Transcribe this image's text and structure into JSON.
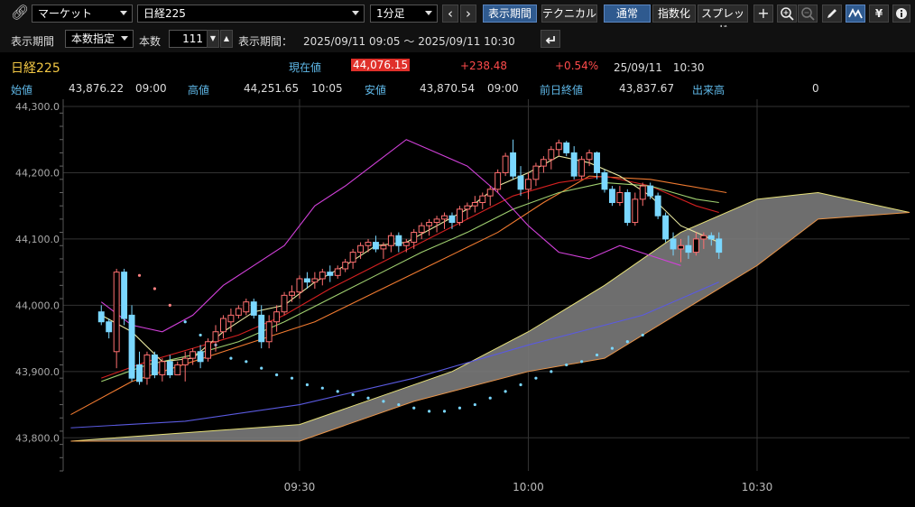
{
  "toolbar": {
    "link_icon": "link-icon",
    "market_select": "マーケット",
    "symbol_select": "日経225",
    "interval_select": "1分足",
    "prev_label": "‹",
    "next_label": "›",
    "period_button": "表示期間",
    "technical_button": "テクニカル",
    "normal_button": "通常",
    "index_button": "指数化",
    "spread_button": "スプレッド",
    "icons": [
      "crosshair-icon",
      "zoom-in-icon",
      "zoom-out-icon",
      "pencil-icon",
      "chart-style-icon",
      "yen-icon",
      "info-icon"
    ]
  },
  "period": {
    "label": "表示期間",
    "mode_select": "本数指定",
    "count_label": "本数",
    "count_value": "111",
    "range_label": "表示期間：",
    "range_value": "2025/09/11 09:05 ～ 2025/09/11 10:30"
  },
  "quote": {
    "name": "日経225",
    "current_label": "現在値",
    "current_value": "44,076.15",
    "change": "+238.48",
    "change_pct": "+0.54%",
    "datetime": "25/09/11　10:30",
    "open_label": "始値",
    "open_value": "43,876.22",
    "open_time": "09:00",
    "high_label": "高値",
    "high_value": "44,251.65",
    "high_time": "10:05",
    "low_label": "安値",
    "low_value": "43,870.54",
    "low_time": "09:00",
    "prev_close_label": "前日終値",
    "prev_close_value": "43,837.67",
    "volume_label": "出来高",
    "volume_value": "0",
    "colors": {
      "up": "#ff4b4b",
      "label": "#5fb8e8",
      "name": "#f2c744"
    }
  },
  "chart_data": {
    "type": "candlestick",
    "ylim": [
      43750,
      44300
    ],
    "y_ticks": [
      "44,300.0",
      "44,200.0",
      "44,100.0",
      "44,000.0",
      "43,900.0",
      "43,800.0"
    ],
    "x_ticks": [
      "09:30",
      "10:00",
      "10:30"
    ],
    "x_tick_minutes": [
      30,
      60,
      90
    ],
    "x_range_minutes": [
      -1,
      110
    ],
    "grid": true,
    "candles": [
      [
        4,
        43990,
        44000,
        43970,
        43975
      ],
      [
        5,
        43975,
        43980,
        43950,
        43960
      ],
      [
        6,
        43930,
        44055,
        43905,
        44050
      ],
      [
        7,
        44050,
        44055,
        43970,
        43980
      ],
      [
        8,
        43985,
        44000,
        43885,
        43890
      ],
      [
        9,
        43910,
        43930,
        43880,
        43885
      ],
      [
        10,
        43890,
        43930,
        43880,
        43925
      ],
      [
        11,
        43925,
        43930,
        43890,
        43895
      ],
      [
        12,
        43895,
        43920,
        43885,
        43915
      ],
      [
        13,
        43915,
        43925,
        43890,
        43895
      ],
      [
        14,
        43895,
        43915,
        43895,
        43910
      ],
      [
        15,
        43910,
        43930,
        43885,
        43920
      ],
      [
        16,
        43920,
        43935,
        43910,
        43930
      ],
      [
        17,
        43930,
        43940,
        43905,
        43915
      ],
      [
        18,
        43920,
        43950,
        43915,
        43945
      ],
      [
        19,
        43945,
        43970,
        43930,
        43960
      ],
      [
        20,
        43960,
        43985,
        43950,
        43980
      ],
      [
        21,
        43975,
        43995,
        43960,
        43985
      ],
      [
        22,
        43985,
        44000,
        43980,
        43995
      ],
      [
        23,
        43990,
        44010,
        43985,
        44005
      ],
      [
        24,
        44005,
        44010,
        43980,
        43985
      ],
      [
        25,
        43985,
        44000,
        43935,
        43945
      ],
      [
        26,
        43945,
        43985,
        43935,
        43975
      ],
      [
        27,
        43975,
        44000,
        43960,
        43990
      ],
      [
        28,
        43990,
        44020,
        43985,
        44015
      ],
      [
        29,
        44015,
        44030,
        44005,
        44020
      ],
      [
        30,
        44020,
        44045,
        44010,
        44040
      ],
      [
        31,
        44040,
        44050,
        44025,
        44035
      ],
      [
        32,
        44035,
        44050,
        44025,
        44040
      ],
      [
        33,
        44040,
        44055,
        44030,
        44050
      ],
      [
        34,
        44050,
        44060,
        44035,
        44045
      ],
      [
        35,
        44045,
        44060,
        44040,
        44055
      ],
      [
        36,
        44055,
        44070,
        44050,
        44065
      ],
      [
        37,
        44065,
        44085,
        44055,
        44080
      ],
      [
        38,
        44080,
        44095,
        44070,
        44090
      ],
      [
        39,
        44090,
        44100,
        44080,
        44095
      ],
      [
        40,
        44095,
        44105,
        44080,
        44085
      ],
      [
        41,
        44085,
        44095,
        44070,
        44090
      ],
      [
        42,
        44090,
        44110,
        44080,
        44105
      ],
      [
        43,
        44105,
        44110,
        44080,
        44090
      ],
      [
        44,
        44090,
        44100,
        44080,
        44095
      ],
      [
        45,
        44095,
        44115,
        44085,
        44110
      ],
      [
        46,
        44110,
        44125,
        44100,
        44120
      ],
      [
        47,
        44120,
        44130,
        44105,
        44125
      ],
      [
        48,
        44125,
        44135,
        44110,
        44130
      ],
      [
        49,
        44130,
        44140,
        44115,
        44135
      ],
      [
        50,
        44135,
        44140,
        44115,
        44125
      ],
      [
        51,
        44125,
        44150,
        44120,
        44145
      ],
      [
        52,
        44145,
        44155,
        44130,
        44150
      ],
      [
        53,
        44150,
        44165,
        44140,
        44155
      ],
      [
        54,
        44155,
        44170,
        44145,
        44165
      ],
      [
        55,
        44165,
        44180,
        44150,
        44175
      ],
      [
        56,
        44175,
        44205,
        44170,
        44200
      ],
      [
        57,
        44200,
        44230,
        44195,
        44225
      ],
      [
        58,
        44230,
        44250,
        44190,
        44195
      ],
      [
        59,
        44195,
        44210,
        44165,
        44175
      ],
      [
        60,
        44175,
        44200,
        44160,
        44190
      ],
      [
        61,
        44190,
        44215,
        44180,
        44210
      ],
      [
        62,
        44210,
        44225,
        44200,
        44220
      ],
      [
        63,
        44220,
        44240,
        44205,
        44235
      ],
      [
        64,
        44235,
        44250,
        44225,
        44245
      ],
      [
        65,
        44245,
        44248,
        44225,
        44230
      ],
      [
        66,
        44230,
        44240,
        44190,
        44195
      ],
      [
        67,
        44195,
        44225,
        44190,
        44220
      ],
      [
        68,
        44220,
        44235,
        44210,
        44230
      ],
      [
        69,
        44230,
        44232,
        44190,
        44200
      ],
      [
        70,
        44200,
        44205,
        44170,
        44175
      ],
      [
        71,
        44175,
        44180,
        44150,
        44155
      ],
      [
        72,
        44155,
        44180,
        44150,
        44170
      ],
      [
        73,
        44170,
        44175,
        44120,
        44125
      ],
      [
        74,
        44125,
        44170,
        44120,
        44160
      ],
      [
        75,
        44160,
        44185,
        44150,
        44180
      ],
      [
        76,
        44180,
        44185,
        44160,
        44165
      ],
      [
        77,
        44165,
        44170,
        44130,
        44135
      ],
      [
        78,
        44135,
        44140,
        44095,
        44100
      ],
      [
        79,
        44100,
        44110,
        44075,
        44085
      ],
      [
        80,
        44085,
        44100,
        44065,
        44090
      ],
      [
        81,
        44090,
        44105,
        44070,
        44080
      ],
      [
        82,
        44080,
        44110,
        44075,
        44100
      ],
      [
        83,
        44100,
        44110,
        44085,
        44105
      ],
      [
        84,
        44105,
        44110,
        44090,
        44100
      ],
      [
        85,
        44100,
        44110,
        44070,
        44080
      ]
    ],
    "sma_short": [
      [
        4,
        43985
      ],
      [
        8,
        43960
      ],
      [
        12,
        43915
      ],
      [
        16,
        43920
      ],
      [
        20,
        43960
      ],
      [
        24,
        43990
      ],
      [
        28,
        44000
      ],
      [
        32,
        44035
      ],
      [
        36,
        44060
      ],
      [
        40,
        44090
      ],
      [
        44,
        44095
      ],
      [
        48,
        44120
      ],
      [
        52,
        44145
      ],
      [
        56,
        44180
      ],
      [
        60,
        44200
      ],
      [
        64,
        44225
      ],
      [
        68,
        44215
      ],
      [
        72,
        44195
      ],
      [
        76,
        44165
      ],
      [
        80,
        44120
      ],
      [
        85,
        44095
      ]
    ],
    "sma_long": [
      [
        4,
        43885
      ],
      [
        10,
        43910
      ],
      [
        16,
        43925
      ],
      [
        22,
        43945
      ],
      [
        28,
        43975
      ],
      [
        34,
        44010
      ],
      [
        40,
        44045
      ],
      [
        46,
        44080
      ],
      [
        52,
        44110
      ],
      [
        58,
        44145
      ],
      [
        64,
        44170
      ],
      [
        70,
        44185
      ],
      [
        76,
        44180
      ],
      [
        82,
        44160
      ],
      [
        85,
        44155
      ]
    ],
    "ema": [
      [
        4,
        43890
      ],
      [
        10,
        43915
      ],
      [
        16,
        43935
      ],
      [
        22,
        43955
      ],
      [
        28,
        43985
      ],
      [
        34,
        44025
      ],
      [
        40,
        44060
      ],
      [
        46,
        44095
      ],
      [
        52,
        44130
      ],
      [
        58,
        44165
      ],
      [
        64,
        44185
      ],
      [
        70,
        44195
      ],
      [
        76,
        44180
      ],
      [
        82,
        44150
      ],
      [
        85,
        44140
      ]
    ],
    "ema_long": [
      [
        0,
        43835
      ],
      [
        8,
        43885
      ],
      [
        16,
        43915
      ],
      [
        24,
        43945
      ],
      [
        32,
        43975
      ],
      [
        40,
        44020
      ],
      [
        48,
        44065
      ],
      [
        56,
        44110
      ],
      [
        62,
        44155
      ],
      [
        68,
        44195
      ],
      [
        76,
        44190
      ],
      [
        86,
        44170
      ]
    ],
    "lagging_span": [
      [
        4,
        44005
      ],
      [
        8,
        43970
      ],
      [
        12,
        43960
      ],
      [
        16,
        43985
      ],
      [
        20,
        44030
      ],
      [
        24,
        44060
      ],
      [
        28,
        44090
      ],
      [
        32,
        44150
      ],
      [
        36,
        44180
      ],
      [
        40,
        44215
      ],
      [
        44,
        44250
      ],
      [
        48,
        44230
      ],
      [
        52,
        44210
      ],
      [
        56,
        44170
      ],
      [
        60,
        44120
      ],
      [
        64,
        44080
      ],
      [
        68,
        44070
      ],
      [
        72,
        44090
      ],
      [
        76,
        44075
      ],
      [
        80,
        44060
      ]
    ],
    "moving_average_slow": [
      [
        0,
        43815
      ],
      [
        15,
        43825
      ],
      [
        30,
        43850
      ],
      [
        45,
        43890
      ],
      [
        60,
        43940
      ],
      [
        75,
        43985
      ],
      [
        85,
        44035
      ]
    ],
    "parabolic_sar": [
      [
        9,
        44045
      ],
      [
        11,
        44025
      ],
      [
        13,
        44000
      ],
      [
        15,
        43975
      ],
      [
        17,
        43955
      ],
      [
        19,
        43940
      ],
      [
        21,
        43920
      ],
      [
        23,
        43915
      ],
      [
        25,
        43905
      ],
      [
        27,
        43895
      ],
      [
        29,
        43890
      ],
      [
        31,
        43880
      ],
      [
        33,
        43875
      ],
      [
        35,
        43870
      ],
      [
        37,
        43865
      ],
      [
        39,
        43860
      ],
      [
        41,
        43855
      ],
      [
        43,
        43850
      ],
      [
        45,
        43845
      ],
      [
        47,
        43840
      ],
      [
        49,
        43840
      ],
      [
        51,
        43845
      ],
      [
        53,
        43850
      ],
      [
        55,
        43860
      ],
      [
        57,
        43870
      ],
      [
        59,
        43880
      ],
      [
        61,
        43890
      ],
      [
        63,
        43900
      ],
      [
        65,
        43910
      ],
      [
        67,
        43915
      ],
      [
        69,
        43925
      ],
      [
        71,
        43935
      ],
      [
        73,
        43945
      ],
      [
        75,
        43955
      ]
    ],
    "ichimoku_span_a": [
      [
        0,
        43795
      ],
      [
        30,
        43820
      ],
      [
        40,
        43860
      ],
      [
        50,
        43900
      ],
      [
        60,
        43960
      ],
      [
        70,
        44030
      ],
      [
        80,
        44110
      ],
      [
        90,
        44160
      ],
      [
        98,
        44170
      ],
      [
        110,
        44140
      ]
    ],
    "ichimoku_span_b": [
      [
        0,
        43795
      ],
      [
        30,
        43795
      ],
      [
        45,
        43855
      ],
      [
        60,
        43900
      ],
      [
        70,
        43920
      ],
      [
        80,
        43990
      ],
      [
        90,
        44060
      ],
      [
        98,
        44130
      ],
      [
        110,
        44140
      ]
    ]
  }
}
